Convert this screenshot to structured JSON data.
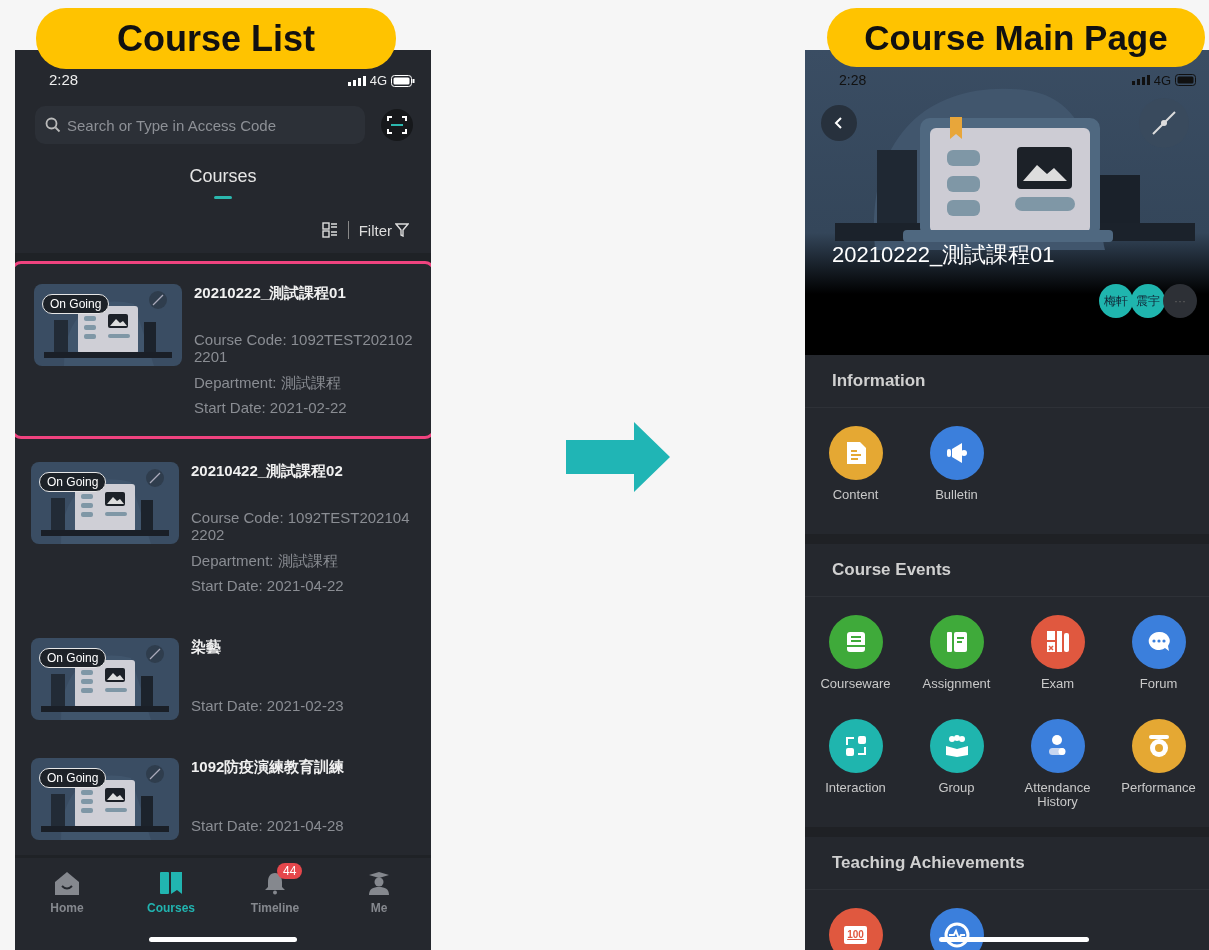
{
  "labels": [
    {
      "text": "Course List"
    },
    {
      "text": "Course Main Page"
    }
  ],
  "course_list": {
    "status_bar": {
      "time": "2:28",
      "network": "4G"
    },
    "search": {
      "placeholder": "Search or Type in Access Code"
    },
    "tabs": [
      {
        "label": "Courses",
        "selected": true
      }
    ],
    "filter": {
      "label": "Filter"
    },
    "courses": [
      {
        "title": "20210222_測試課程01",
        "status": "On Going",
        "code": "Course Code: 1092TEST2021022201",
        "department": "Department: 測試課程",
        "start": "Start Date: 2021-02-22",
        "selected": true
      },
      {
        "title": "20210422_測試課程02",
        "status": "On Going",
        "code": "Course Code: 1092TEST2021042202",
        "department": "Department: 測試課程",
        "start": "Start Date: 2021-04-22",
        "selected": false
      },
      {
        "title": "染藝",
        "status": "On Going",
        "start": "Start Date: 2021-02-23",
        "selected": false
      },
      {
        "title": "1092防疫演練教育訓練",
        "status": "On Going",
        "start": "Start Date: 2021-04-28",
        "selected": false
      }
    ],
    "nav": [
      {
        "label": "Home",
        "kind": "home",
        "selected": false
      },
      {
        "label": "Courses",
        "kind": "courses",
        "selected": true
      },
      {
        "label": "Timeline",
        "kind": "bell",
        "selected": false,
        "badge": "44"
      },
      {
        "label": "Me",
        "kind": "me",
        "selected": false
      }
    ]
  },
  "course_main": {
    "status_bar": {
      "time": "2:28",
      "network": "4G"
    },
    "title": "20210222_測試課程01",
    "members": [
      {
        "name": "梅軒"
      },
      {
        "name": "震宇"
      },
      {
        "name": "···"
      }
    ],
    "sections": [
      {
        "heading": "Information",
        "items": [
          {
            "label": "Content",
            "kind": "doc",
            "color": "#e5a833"
          },
          {
            "label": "Bulletin",
            "kind": "megaphone",
            "color": "#3b7fdc"
          }
        ]
      },
      {
        "heading": "Course Events",
        "items": [
          {
            "label": "Courseware",
            "kind": "tray",
            "color": "#3faa3a"
          },
          {
            "label": "Assignment",
            "kind": "book",
            "color": "#3faa3a"
          },
          {
            "label": "Exam",
            "kind": "calc",
            "color": "#e0583f"
          },
          {
            "label": "Forum",
            "kind": "chat",
            "color": "#3b7fdc"
          },
          {
            "label": "Interaction",
            "kind": "nodes",
            "color": "#1fb5ae"
          },
          {
            "label": "Group",
            "kind": "people",
            "color": "#1fb5ae"
          },
          {
            "label": "Attendance History",
            "kind": "person",
            "color": "#3b7fdc"
          },
          {
            "label": "Performance",
            "kind": "medal",
            "color": "#e5a833"
          }
        ]
      },
      {
        "heading": "Teaching Achievements",
        "items": [
          {
            "kind": "score",
            "color": "#e0583f",
            "glyph": "100"
          },
          {
            "kind": "pulse",
            "color": "#3b7fdc"
          }
        ]
      }
    ]
  }
}
